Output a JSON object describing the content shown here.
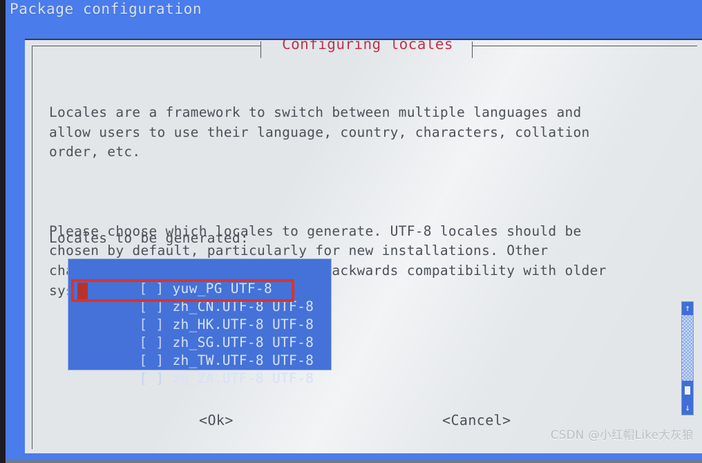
{
  "header": {
    "app_title": "Package configuration"
  },
  "dialog": {
    "title": "Configuring locales",
    "title_color": "#c0334a",
    "background_color": "#e2e6e9",
    "paragraphs": [
      "Locales are a framework to switch between multiple languages and\nallow users to use their language, country, characters, collation\norder, etc.",
      "Please choose which locales to generate. UTF-8 locales should be\nchosen by default, particularly for new installations. Other\ncharacter sets may be useful for backwards compatibility with older\nsystems and software."
    ],
    "list_label": "Locales to be generated:"
  },
  "locale_list": {
    "selection_color": "#4472d8",
    "text_color": "#d7e1f7",
    "items": [
      {
        "checkbox": "[ ]",
        "name": "yuw_PG UTF-8",
        "checked": false,
        "highlighted": false
      },
      {
        "checkbox": "[ ]",
        "name": "zh_CN.UTF-8 UTF-8",
        "checked": false,
        "highlighted": true
      },
      {
        "checkbox": "[ ]",
        "name": "zh_HK.UTF-8 UTF-8",
        "checked": false,
        "highlighted": false
      },
      {
        "checkbox": "[ ]",
        "name": "zh_SG.UTF-8 UTF-8",
        "checked": false,
        "highlighted": false
      },
      {
        "checkbox": "[ ]",
        "name": "zh_TW.UTF-8 UTF-8",
        "checked": false,
        "highlighted": false
      },
      {
        "checkbox": "[ ]",
        "name": "zu_ZA.UTF-8 UTF-8",
        "checked": false,
        "highlighted": false
      }
    ]
  },
  "annotation": {
    "color": "#e03127",
    "target_row": "zh_CN.UTF-8 UTF-8"
  },
  "scrollbar": {
    "up_arrow": "↑",
    "down_arrow": "↓",
    "thumb_position": "near-bottom"
  },
  "buttons": {
    "ok": "<Ok>",
    "cancel": "<Cancel>"
  },
  "watermark": {
    "text": "CSDN @小红帽Like大灰狼"
  }
}
